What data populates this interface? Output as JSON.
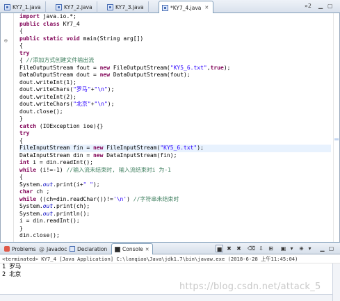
{
  "tabs": [
    {
      "label": "KY7_1.java",
      "active": false
    },
    {
      "label": "KY7_2.java",
      "active": false
    },
    {
      "label": "KY7_3.java",
      "active": false
    },
    {
      "label": "*KY7_4.java",
      "active": true
    }
  ],
  "tab_overflow": "»2",
  "code": [
    [
      [
        "kw",
        "import"
      ],
      [
        "n",
        " java.io.*;"
      ]
    ],
    [
      [
        "kw",
        "public class"
      ],
      [
        "n",
        " KY7_4"
      ]
    ],
    [
      [
        "n",
        "{"
      ]
    ],
    [
      [
        "kw",
        "public static void"
      ],
      [
        "n",
        " main(String arg[])"
      ]
    ],
    [
      [
        "n",
        "{"
      ]
    ],
    [
      [
        "kw",
        "try"
      ]
    ],
    [
      [
        "n",
        "{ "
      ],
      [
        "cm",
        "//添加方式创建文件输出流"
      ]
    ],
    [
      [
        "n",
        "FileOutputStream fout = "
      ],
      [
        "kw",
        "new"
      ],
      [
        "n",
        " FileOutputStream("
      ],
      [
        "str",
        "\"KY5_6.txt\""
      ],
      [
        "n",
        ","
      ],
      [
        "kw",
        "true"
      ],
      [
        "n",
        ");"
      ]
    ],
    [
      [
        "n",
        "DataOutputStream dout = "
      ],
      [
        "kw",
        "new"
      ],
      [
        "n",
        " DataOutputStream(fout);"
      ]
    ],
    [
      [
        "n",
        "dout.writeInt(1);"
      ]
    ],
    [
      [
        "n",
        "dout.writeChars("
      ],
      [
        "str",
        "\"罗马\""
      ],
      [
        "n",
        "+"
      ],
      [
        "str",
        "\"\\n\""
      ],
      [
        "n",
        ");"
      ]
    ],
    [
      [
        "n",
        "dout.writeInt(2);"
      ]
    ],
    [
      [
        "n",
        "dout.writeChars("
      ],
      [
        "str",
        "\"北京\""
      ],
      [
        "n",
        "+"
      ],
      [
        "str",
        "\"\\n\""
      ],
      [
        "n",
        ");"
      ]
    ],
    [
      [
        "n",
        "dout.close();"
      ]
    ],
    [
      [
        "n",
        "}"
      ]
    ],
    [
      [
        "kw",
        "catch"
      ],
      [
        "n",
        " (IOException ioe){}"
      ]
    ],
    [
      [
        "kw",
        "try"
      ]
    ],
    [
      [
        "n",
        "{"
      ]
    ],
    [
      [
        "n",
        "FileInputStream fin = "
      ],
      [
        "kw",
        "new"
      ],
      [
        "n",
        " FileInputStream("
      ],
      [
        "str",
        "\"KY5_6.txt\""
      ],
      [
        "n",
        ");"
      ]
    ],
    [
      [
        "n",
        "DataInputStream din = "
      ],
      [
        "kw",
        "new"
      ],
      [
        "n",
        " DataInputStream(fin);"
      ]
    ],
    [
      [
        "kw",
        "int"
      ],
      [
        "n",
        " i = din.readInt();"
      ]
    ],
    [
      [
        "kw",
        "while"
      ],
      [
        "n",
        " (i!=-1) "
      ],
      [
        "cm",
        "//输入流未结束时, 输入流结束时i 为-1"
      ]
    ],
    [
      [
        "n",
        "{"
      ]
    ],
    [
      [
        "n",
        "System."
      ],
      [
        "fld",
        "out"
      ],
      [
        "n",
        ".print(i+"
      ],
      [
        "str",
        "\" \""
      ],
      [
        "n",
        ");"
      ]
    ],
    [
      [
        "kw",
        "char"
      ],
      [
        "n",
        " ch ;"
      ]
    ],
    [
      [
        "kw",
        "while"
      ],
      [
        "n",
        " ((ch=din.readChar())!="
      ],
      [
        "str",
        "'\\n'"
      ],
      [
        "n",
        ") "
      ],
      [
        "cm",
        "//字符串未结束时"
      ]
    ],
    [
      [
        "n",
        "System."
      ],
      [
        "fld",
        "out"
      ],
      [
        "n",
        ".print(ch);"
      ]
    ],
    [
      [
        "n",
        "System."
      ],
      [
        "fld",
        "out"
      ],
      [
        "n",
        ".println();"
      ]
    ],
    [
      [
        "n",
        "i = din.readInt();"
      ]
    ],
    [
      [
        "n",
        "}"
      ]
    ],
    [
      [
        "n",
        "din.close();"
      ]
    ]
  ],
  "current_line": 18,
  "views": {
    "problems": "Problems",
    "javadoc": "Javadoc",
    "declaration": "Declaration",
    "console": "Console"
  },
  "console_description": "<terminated> KY7_4 [Java Application] C:\\lanqiao\\Java\\jdk1.7\\bin\\javaw.exe (2018-6-28 上午11:45:04)",
  "console_lines": [
    "1 罗马",
    "2 北京"
  ],
  "watermark": "https://blog.csdn.net/attack_5",
  "colors": {
    "keyword": "#7f0055",
    "string": "#2a00ff",
    "comment": "#3f7f5f",
    "field": "#0000c0",
    "current_line": "#e8f2fe"
  }
}
